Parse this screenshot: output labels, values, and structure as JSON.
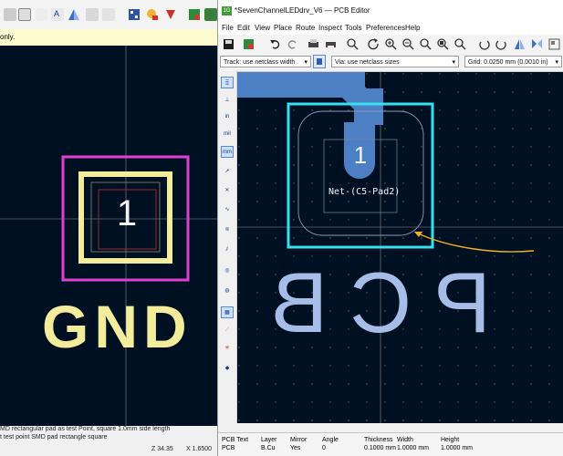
{
  "left_window": {
    "info_text": "only.",
    "canvas": {
      "pad_number": "1",
      "net_label": "GND"
    },
    "status": {
      "line1": "MD rectangular pad as test Point, square 1.0mm side length",
      "line2": "t test point SMD pad rectangle square",
      "zoom_left": "Z 34.35",
      "x_left": "X 1.6500"
    }
  },
  "pcb_editor": {
    "window_title": "*SevenChannelLEDdrv_V6 — PCB Editor",
    "app_badge": "1G",
    "menu": [
      "File",
      "Edit",
      "View",
      "Place",
      "Route",
      "Inspect",
      "Tools",
      "Preferences",
      "Help"
    ],
    "track_select": "Track: use netclass width",
    "via_select": "Via: use netclass sizes",
    "grid_select": "Grid: 0.0250 mm (0.0010 in)",
    "left_toolbar": {
      "in_label": "in",
      "mil_label": "mil",
      "mm_label": "mm"
    },
    "canvas": {
      "pad_number": "1",
      "pad_net_label": "Net-(C5-Pad2)",
      "silk_text": "PCB"
    },
    "message_panel": {
      "columns": [
        {
          "header": "PCB Text",
          "value": "PCB"
        },
        {
          "header": "Layer",
          "value": "B.Cu"
        },
        {
          "header": "Mirror",
          "value": "Yes"
        },
        {
          "header": "Angle",
          "value": "0"
        },
        {
          "header": "Thickness",
          "value": "0.1000 mm"
        },
        {
          "header": "Width",
          "value": "1.0000 mm"
        },
        {
          "header": "Height",
          "value": "1.0000 mm"
        }
      ]
    }
  },
  "colors": {
    "canvas_bg": "#001023",
    "pad_yellow": "#f3ec9b",
    "courtyard_magenta": "#e23fd2",
    "selection_cyan": "#35e0ef",
    "copper_track": "#4d7fc4",
    "silk_back": "#a6bde8",
    "annotation_arrow": "#f5b11c"
  }
}
